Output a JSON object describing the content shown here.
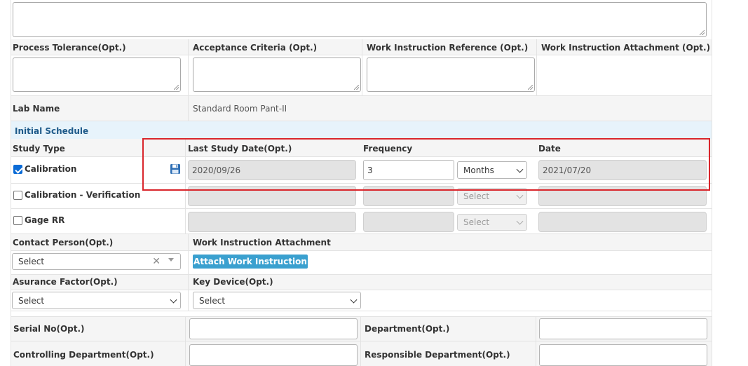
{
  "labels": {
    "process_tolerance": "Process Tolerance(Opt.)",
    "acceptance_criteria": "Acceptance Criteria (Opt.)",
    "wi_reference": "Work Instruction Reference (Opt.)",
    "wi_attachment_opt": "Work Instruction Attachment (Opt.)",
    "lab_name": "Lab Name",
    "contact_person": "Contact Person(Opt.)",
    "wi_attachment": "Work Instruction Attachment",
    "assurance_factor": "Asurance Factor(Opt.)",
    "key_device": "Key Device(Opt.)",
    "serial_no": "Serial No(Opt.)",
    "department": "Department(Opt.)",
    "controlling_department": "Controlling Department(Opt.)",
    "responsible_department": "Responsible Department(Opt.)"
  },
  "lab_name_value": "Standard Room Pant-II",
  "schedule": {
    "section_title": "Initial Schedule",
    "headers": {
      "study_type": "Study Type",
      "last_study_date": "Last Study Date(Opt.)",
      "frequency": "Frequency",
      "date": "Date"
    },
    "rows": [
      {
        "name": "Calibration",
        "checked": true,
        "last_study_date": "2020/09/26",
        "frequency": "3",
        "unit": "Months",
        "date": "2021/07/20"
      },
      {
        "name": "Calibration - Verification",
        "checked": false,
        "last_study_date": "",
        "frequency": "",
        "unit": "Select",
        "date": ""
      },
      {
        "name": "Gage RR",
        "checked": false,
        "last_study_date": "",
        "frequency": "",
        "unit": "Select",
        "date": ""
      }
    ]
  },
  "contact_person_select": "Select",
  "attach_button": "Attach Work Instruction",
  "assurance_select": "Select",
  "key_device_select": "Select",
  "icons": {
    "save": "save-icon",
    "clear": "clear-icon",
    "dropdown": "chevron-down-icon"
  },
  "colors": {
    "highlight": "#d9262c",
    "button": "#3aa0cf",
    "section_bg": "#e7f3fb",
    "section_text": "#1e5a8a",
    "checkbox": "#0b6bd6"
  }
}
